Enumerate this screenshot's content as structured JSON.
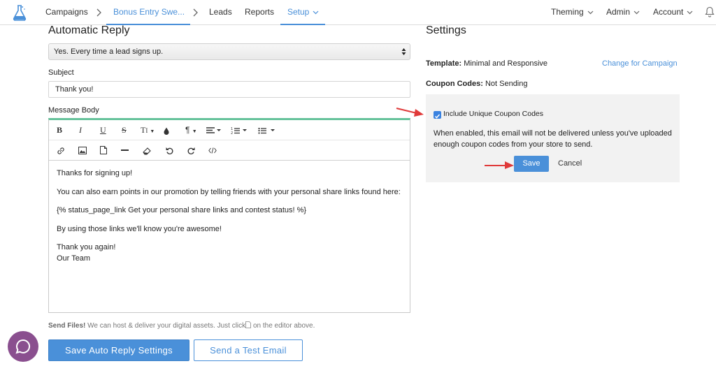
{
  "nav": {
    "items": [
      "Campaigns",
      "Bonus Entry Swe...",
      "Leads",
      "Reports",
      "Setup"
    ],
    "right": [
      "Theming",
      "Admin",
      "Account"
    ],
    "active_color": "#4a90d9"
  },
  "left": {
    "title": "Automatic Reply",
    "select_value": "Yes. Every time a lead signs up.",
    "subject_label": "Subject",
    "subject_value": "Thank you!",
    "body_label": "Message Body",
    "toolbar_row1": [
      "bold-icon",
      "italic-icon",
      "underline-icon",
      "strikethrough-icon",
      "text-size-icon",
      "color-drop-icon",
      "paragraph-icon",
      "align-icon",
      "ordered-list-icon",
      "unordered-list-icon"
    ],
    "toolbar_row2": [
      "link-icon",
      "image-icon",
      "file-icon",
      "horizontal-rule-icon",
      "eraser-icon",
      "undo-icon",
      "redo-icon",
      "code-icon"
    ],
    "body": {
      "line1": "Thanks for signing up!",
      "line2": "You can also earn points in our promotion by telling friends with your personal share links found here:",
      "line3": "{% status_page_link Get your personal share links and contest status! %}",
      "line4": "By using those links we'll know you're awesome!",
      "line5a": "Thank you again!",
      "line5b": "Our Team"
    },
    "send_files_bold": "Send Files!",
    "send_files_text": " We can host & deliver your digital assets. Just click",
    "send_files_tail": " on the editor above.",
    "save_button": "Save Auto Reply Settings",
    "test_button": "Send a Test Email"
  },
  "right": {
    "title": "Settings",
    "template_key": "Template:",
    "template_value": " Minimal and Responsive",
    "change_link": "Change for Campaign",
    "coupon_key": "Coupon Codes:",
    "coupon_value": " Not Sending",
    "checkbox_label": "Include Unique Coupon Codes",
    "checkbox_checked": true,
    "description": "When enabled, this email will not be delivered unless you've uploaded enough coupon codes from your store to send.",
    "save": "Save",
    "cancel": "Cancel"
  }
}
